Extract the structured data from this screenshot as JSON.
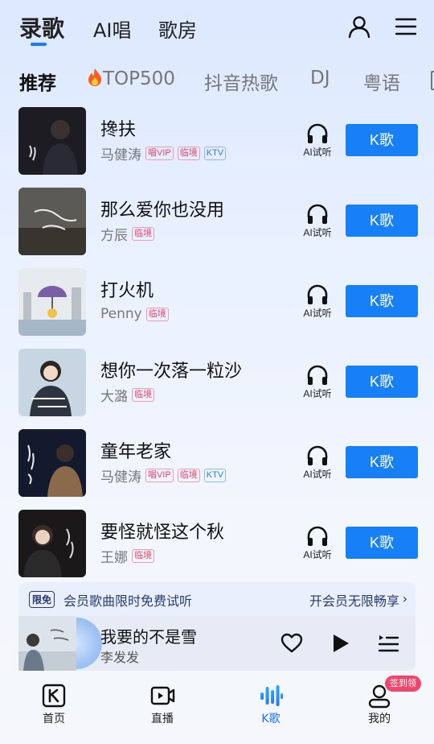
{
  "header": {
    "tabs": [
      {
        "label": "录歌",
        "active": true
      },
      {
        "label": "AI唱",
        "active": false
      },
      {
        "label": "歌房",
        "active": false
      }
    ],
    "icons": [
      "user-icon",
      "menu-icon"
    ]
  },
  "sub_tabs": [
    {
      "label": "推荐",
      "active": true
    },
    {
      "label": "TOP500",
      "icon": "fire-icon",
      "active": false
    },
    {
      "label": "抖音热歌",
      "active": false
    },
    {
      "label": "DJ",
      "active": false
    },
    {
      "label": "粤语",
      "active": false
    }
  ],
  "songs": [
    {
      "title": "搀扶",
      "artist": "马健涛",
      "tags": [
        "唱VIP",
        "临境",
        "KTV"
      ],
      "ai_label": "AI试听",
      "k_label": "K歌"
    },
    {
      "title": "那么爱你也没用",
      "artist": "方辰",
      "tags": [
        "临境"
      ],
      "ai_label": "AI试听",
      "k_label": "K歌"
    },
    {
      "title": "打火机",
      "artist": "Penny",
      "tags": [
        "临境"
      ],
      "ai_label": "AI试听",
      "k_label": "K歌"
    },
    {
      "title": "想你一次落一粒沙",
      "artist": "大潞",
      "tags": [
        "临境"
      ],
      "ai_label": "AI试听",
      "k_label": "K歌"
    },
    {
      "title": "童年老家",
      "artist": "马健涛",
      "tags": [
        "唱VIP",
        "临境",
        "KTV"
      ],
      "ai_label": "AI试听",
      "k_label": "K歌"
    },
    {
      "title": "要怪就怪这个秋",
      "artist": "王娜",
      "tags": [
        "临境"
      ],
      "ai_label": "AI试听",
      "k_label": "K歌"
    }
  ],
  "promo": {
    "badge": "限免",
    "text": "会员歌曲限时免费试听",
    "link": "开会员无限畅享",
    "chevron": "›"
  },
  "player": {
    "title": "我要的不是雪",
    "artist": "李发发",
    "icons": [
      "heart-icon",
      "play-icon",
      "playlist-icon"
    ]
  },
  "bottom_nav": {
    "items": [
      {
        "label": "首页",
        "icon": "home-k-icon",
        "active": false
      },
      {
        "label": "直播",
        "icon": "live-icon",
        "active": false
      },
      {
        "label": "K歌",
        "icon": "k-song-wave-icon",
        "active": true
      },
      {
        "label": "我的",
        "icon": "profile-icon",
        "active": false
      }
    ],
    "badge": "签到领"
  },
  "colors": {
    "accent": "#1780f7",
    "active_tab_text": "#1a6fff",
    "tag_red": "#e6456a",
    "tag_blue": "#2f7cf0",
    "promo_text": "#2a3b74"
  }
}
